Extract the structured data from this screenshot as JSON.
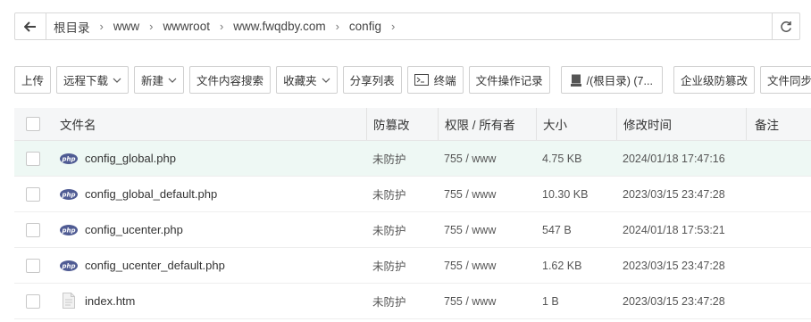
{
  "breadcrumb": {
    "items": [
      "根目录",
      "www",
      "wwwroot",
      "www.fwqdby.com",
      "config"
    ]
  },
  "toolbar": {
    "upload": "上传",
    "remote_download": "远程下载",
    "new": "新建",
    "content_search": "文件内容搜索",
    "favorites": "收藏夹",
    "share_list": "分享列表",
    "terminal": "终端",
    "operation_log": "文件操作记录",
    "disk": "/(根目录) (7...",
    "tamper_protect": "企业级防篡改",
    "file_sync": "文件同步"
  },
  "table": {
    "headers": {
      "name": "文件名",
      "protect": "防篡改",
      "perm": "权限 / 所有者",
      "size": "大小",
      "mtime": "修改时间",
      "note": "备注"
    },
    "rows": [
      {
        "name": "config_global.php",
        "icon": "php-file-icon",
        "protect": "未防护",
        "perm": "755 / www",
        "size": "4.75 KB",
        "mtime": "2024/01/18 17:47:16"
      },
      {
        "name": "config_global_default.php",
        "icon": "php-file-icon",
        "protect": "未防护",
        "perm": "755 / www",
        "size": "10.30 KB",
        "mtime": "2023/03/15 23:47:28"
      },
      {
        "name": "config_ucenter.php",
        "icon": "php-file-icon",
        "protect": "未防护",
        "perm": "755 / www",
        "size": "547 B",
        "mtime": "2024/01/18 17:53:21"
      },
      {
        "name": "config_ucenter_default.php",
        "icon": "php-file-icon",
        "protect": "未防护",
        "perm": "755 / www",
        "size": "1.62 KB",
        "mtime": "2023/03/15 23:47:28"
      },
      {
        "name": "index.htm",
        "icon": "document-file-icon",
        "protect": "未防护",
        "perm": "755 / www",
        "size": "1 B",
        "mtime": "2023/03/15 23:47:28"
      }
    ]
  },
  "colors": {
    "highlight_row": "#eef8f4",
    "php_badge": "#4f5b93",
    "border": "#d0d0d0"
  }
}
